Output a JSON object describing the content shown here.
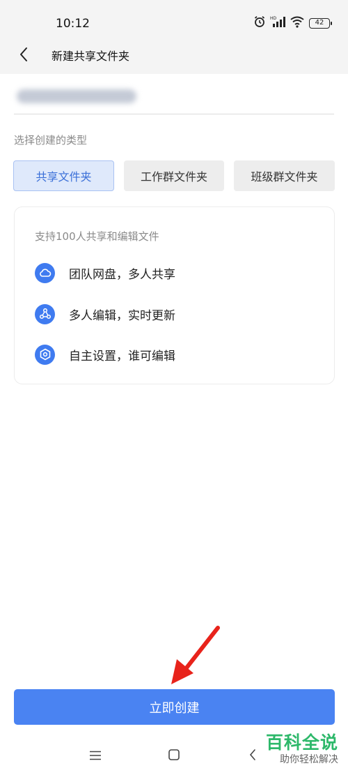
{
  "status_bar": {
    "time": "10:12",
    "battery": "42"
  },
  "header": {
    "title": "新建共享文件夹"
  },
  "type_section": {
    "label": "选择创建的类型",
    "options": [
      "共享文件夹",
      "工作群文件夹",
      "班级群文件夹"
    ],
    "selected": "共享文件夹"
  },
  "card": {
    "description": "支持100人共享和编辑文件",
    "features": [
      {
        "text": "团队网盘，多人共享",
        "icon": "cloud-icon"
      },
      {
        "text": "多人编辑，实时更新",
        "icon": "people-network-icon"
      },
      {
        "text": "自主设置，谁可编辑",
        "icon": "settings-hexagon-icon"
      }
    ]
  },
  "create_button": {
    "label": "立即创建"
  },
  "watermark": {
    "title": "百科全说",
    "subtitle": "助你轻松解决"
  },
  "colors": {
    "accent": "#4a83f2",
    "selected_bg": "#dfe9fb",
    "selected_text": "#3a6fd8",
    "annotation": "#e8231b",
    "watermark": "#2db86a"
  }
}
